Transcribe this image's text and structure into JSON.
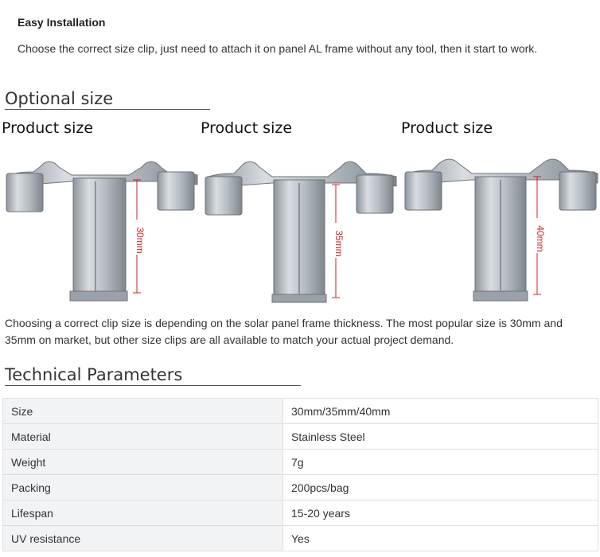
{
  "intro": {
    "title": "Easy Installation",
    "text": "Choose the correct size clip, just need to attach it on panel AL frame without any tool, then it start to work."
  },
  "optional_size": {
    "heading": "Optional size",
    "products": [
      {
        "label": "Product size",
        "dimension": "30mm"
      },
      {
        "label": "Product size",
        "dimension": "35mm"
      },
      {
        "label": "Product size",
        "dimension": "40mm"
      }
    ]
  },
  "description": "Choosing a correct clip size is depending on the solar panel frame thickness. The most popular size is 30mm and   35mm on market, but other size clips are all available to match your actual project demand.",
  "technical": {
    "heading": "Technical Parameters",
    "rows": [
      {
        "key": "Size",
        "value": "30mm/35mm/40mm"
      },
      {
        "key": "Material",
        "value": "Stainless Steel"
      },
      {
        "key": "Weight",
        "value": "7g"
      },
      {
        "key": "Packing",
        "value": "200pcs/bag"
      },
      {
        "key": "Lifespan",
        "value": "15-20 years"
      },
      {
        "key": "UV resistance",
        "value": "Yes"
      }
    ]
  }
}
